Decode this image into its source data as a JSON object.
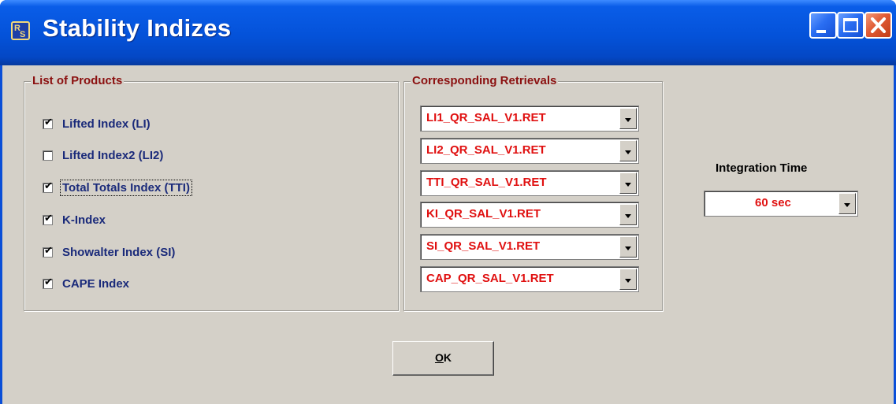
{
  "window": {
    "title": "Stability Indizes",
    "controls": [
      "minimize",
      "maximize",
      "close"
    ]
  },
  "products_group": {
    "title": "List of Products",
    "items": [
      {
        "label": "Lifted Index (LI)",
        "checked": true
      },
      {
        "label": "Lifted Index2 (LI2)",
        "checked": false
      },
      {
        "label": "Total Totals Index (TTI)",
        "checked": true
      },
      {
        "label": "K-Index",
        "checked": true
      },
      {
        "label": "Showalter Index (SI)",
        "checked": true
      },
      {
        "label": "CAPE Index",
        "checked": true
      }
    ]
  },
  "retrievals_group": {
    "title": "Corresponding Retrievals",
    "items": [
      {
        "value": "LI1_QR_SAL_V1.RET"
      },
      {
        "value": "LI2_QR_SAL_V1.RET"
      },
      {
        "value": "TTI_QR_SAL_V1.RET"
      },
      {
        "value": "KI_QR_SAL_V1.RET"
      },
      {
        "value": "SI_QR_SAL_V1.RET"
      },
      {
        "value": "CAP_QR_SAL_V1.RET"
      }
    ]
  },
  "integration": {
    "label": "Integration Time",
    "value": "60 sec"
  },
  "ok_button": {
    "mnemonic": "O",
    "rest": "K"
  },
  "colors": {
    "titlebar": "#0452d9",
    "dialog_bg": "#d4d0c8",
    "group_title": "#8b1010",
    "product_label": "#1a2a7a",
    "retrieval_text": "#e01010"
  }
}
